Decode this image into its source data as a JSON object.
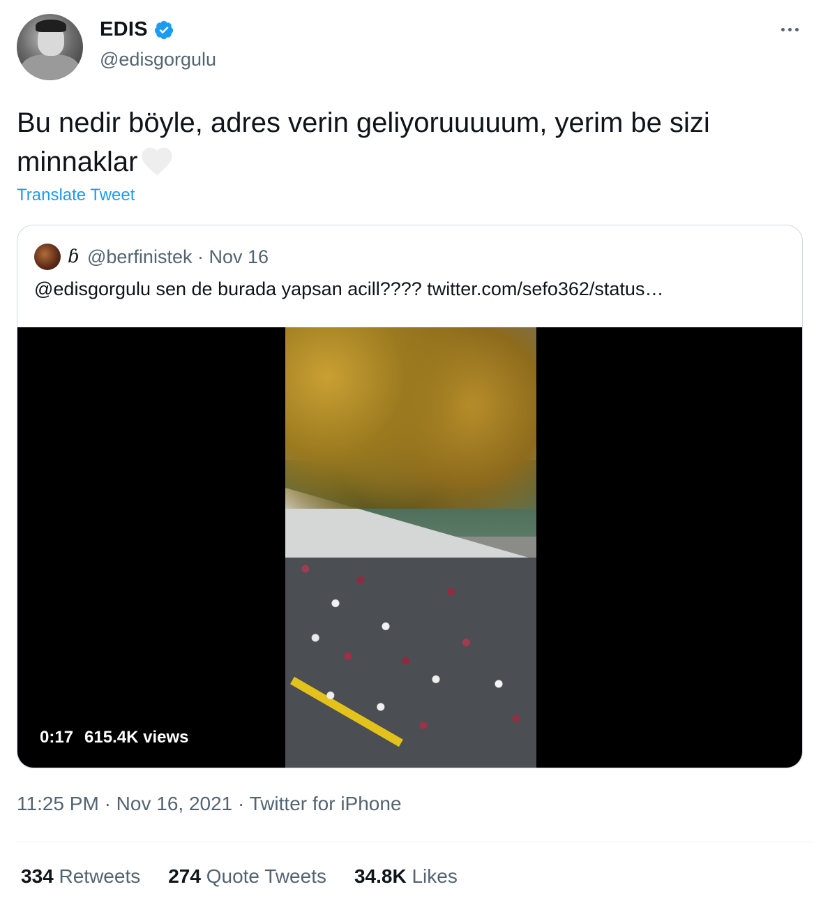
{
  "author": {
    "display_name": "EDIS",
    "handle": "@edisgorgulu",
    "verified": true,
    "avatar_icon": "user-avatar"
  },
  "more_icon": "more-horizontal-icon",
  "tweet": {
    "text": "Bu nedir böyle, adres verin geliyoruuuuum, yerim be sizi minnaklar",
    "emoji": "white-heart",
    "translate_label": "Translate Tweet"
  },
  "quoted_tweet": {
    "glyph": "ɓ",
    "handle": "@berfinistek",
    "separator": "·",
    "date": "Nov 16",
    "text": "@edisgorgulu sen de burada yapsan acill????  twitter.com/sefo362/status…",
    "video": {
      "duration": "0:17",
      "views": "615.4K views"
    }
  },
  "meta": {
    "time": "11:25 PM",
    "sep1": "·",
    "date": "Nov 16, 2021",
    "sep2": "·",
    "source": "Twitter for iPhone"
  },
  "stats": {
    "retweets_count": "334",
    "retweets_label": "Retweets",
    "quotes_count": "274",
    "quotes_label": "Quote Tweets",
    "likes_count": "34.8K",
    "likes_label": "Likes"
  },
  "colors": {
    "accent": "#1d9bf0",
    "secondary_text": "#536471",
    "primary_text": "#0f1419",
    "border": "#cfd9de"
  }
}
